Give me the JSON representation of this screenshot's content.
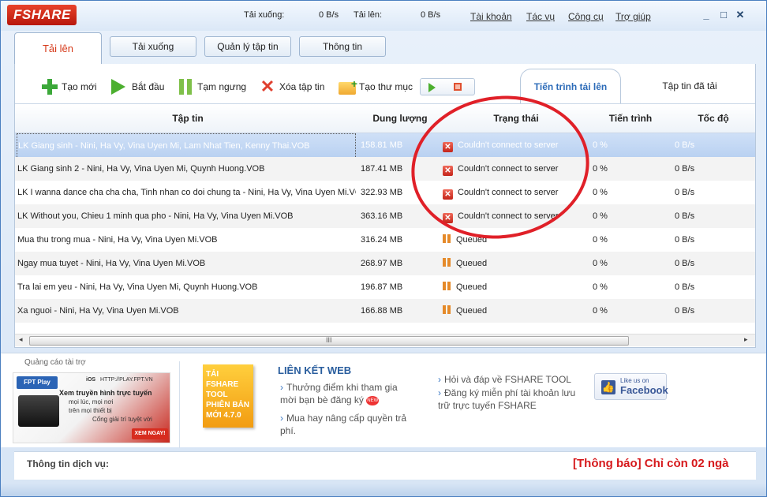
{
  "app": {
    "logo_text": "FSHARE",
    "download_speed_label": "Tải xuống:",
    "download_speed_value": "0 B/s",
    "upload_speed_label": "Tải lên:",
    "upload_speed_value": "0 B/s",
    "menu": [
      "Tài khoản",
      "Tác vụ",
      "Công cụ",
      "Trợ giúp"
    ],
    "window_controls": {
      "minimize": "_",
      "maximize": "□",
      "close": "✕"
    }
  },
  "main_tabs": [
    "Tải lên",
    "Tải xuống",
    "Quản lý tập tin",
    "Thông tin"
  ],
  "toolbar": {
    "new": "Tạo mới",
    "start": "Bắt đầu",
    "pause": "Tạm ngưng",
    "delete": "Xóa tập tin",
    "new_folder": "Tạo thư mục"
  },
  "sub_tabs": [
    "Tiến trình tải lên",
    "Tập tin đã tải"
  ],
  "table": {
    "columns": [
      "Tập tin",
      "Dung lượng",
      "Trạng thái",
      "Tiến trình",
      "Tốc độ"
    ],
    "rows": [
      {
        "name": "LK Giang sinh - Nini, Ha Vy, Vina Uyen Mi, Lam Nhat Tien, Kenny Thai.VOB",
        "size": "158.81 MB",
        "status": "Couldn't connect to server",
        "status_type": "error",
        "progress": "0 %",
        "speed": "0 B/s"
      },
      {
        "name": "LK Giang sinh 2 - Nini, Ha Vy, Vina Uyen Mi, Quynh Huong.VOB",
        "size": "187.41 MB",
        "status": "Couldn't connect to server",
        "status_type": "error",
        "progress": "0 %",
        "speed": "0 B/s"
      },
      {
        "name": "LK I wanna dance cha cha cha, Tinh nhan co doi chung ta - Nini, Ha Vy, Vina Uyen Mi.VOB",
        "size": "322.93 MB",
        "status": "Couldn't connect to server",
        "status_type": "error",
        "progress": "0 %",
        "speed": "0 B/s"
      },
      {
        "name": "LK Without you, Chieu 1 minh qua pho - Nini, Ha Vy, Vina Uyen Mi.VOB",
        "size": "363.16 MB",
        "status": "Couldn't connect to server",
        "status_type": "error",
        "progress": "0 %",
        "speed": "0 B/s"
      },
      {
        "name": "Mua thu trong mua - Nini, Ha Vy, Vina Uyen Mi.VOB",
        "size": "316.24 MB",
        "status": "Queued",
        "status_type": "queued",
        "progress": "0 %",
        "speed": "0 B/s"
      },
      {
        "name": "Ngay mua tuyet - Nini, Ha Vy, Vina Uyen Mi.VOB",
        "size": "268.97 MB",
        "status": "Queued",
        "status_type": "queued",
        "progress": "0 %",
        "speed": "0 B/s"
      },
      {
        "name": "Tra lai em yeu - Nini, Ha Vy, Vina Uyen Mi, Quynh Huong.VOB",
        "size": "196.87 MB",
        "status": "Queued",
        "status_type": "queued",
        "progress": "0 %",
        "speed": "0 B/s"
      },
      {
        "name": "Xa nguoi - Nini, Ha Vy, Vina Uyen Mi.VOB",
        "size": "166.88 MB",
        "status": "Queued",
        "status_type": "queued",
        "progress": "0 %",
        "speed": "0 B/s"
      }
    ]
  },
  "scrollbar": {
    "grip": "III",
    "left_arrow": "◂",
    "right_arrow": "▸"
  },
  "ads": {
    "label": "Quảng cáo tài trợ",
    "fpt": {
      "brand": "FPT Play",
      "os": "iOS",
      "url": "HTTP://PLAY.FPT.VN",
      "line1": "Xem truyền hình trực tuyến",
      "line2": "mọi lúc, mọi nơi",
      "line3": "trên mọi thiết bị",
      "line4": "Cổng giải trí tuyệt vời",
      "cta": "XEM NGAY!"
    },
    "fshare_tool_box": "TẢI FSHARE TOOL PHIÊN BẢN MỚI 4.7.0",
    "links_title": "LIÊN KẾT WEB",
    "links_left": [
      "Thưởng điểm khi tham gia mời bạn bè đăng ký",
      "Mua hay nâng cấp quyền trả phí."
    ],
    "new_badge": "NEW",
    "links_right": [
      "Hỏi và đáp về FSHARE TOOL",
      "Đăng ký miễn phí tài khoản lưu trữ trực tuyến FSHARE"
    ],
    "facebook": {
      "like": "Like us on",
      "name": "Facebook"
    }
  },
  "service": {
    "label": "Thông tin dịch vụ:",
    "notice": "[Thông báo] Chỉ còn 02 ngà"
  }
}
